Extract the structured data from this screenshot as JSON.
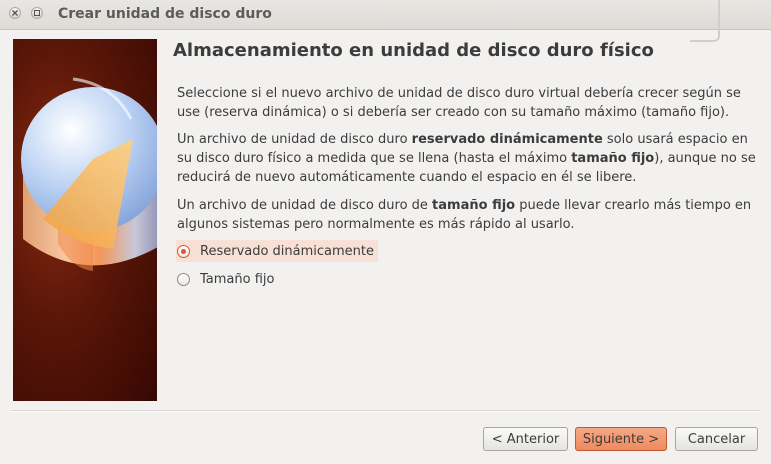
{
  "window": {
    "title": "Crear unidad de disco duro",
    "controls": [
      "close-icon",
      "maximize-icon"
    ]
  },
  "heading": "Almacenamiento en unidad de disco duro físico",
  "paragraphs": {
    "p1": "Seleccione si el nuevo archivo de unidad de disco duro virtual debería crecer según se use (reserva dinámica) o si debería ser creado con su tamaño máximo (tamaño fijo).",
    "p2": {
      "t1": "Un archivo de unidad de disco duro ",
      "b1": "reservado dinámicamente",
      "t2": " solo usará espacio en su disco duro físico a medida que se llena (hasta el máximo ",
      "b2": "tamaño fijo",
      "t3": "), aunque no se reducirá de nuevo automáticamente cuando el espacio en él se libere."
    },
    "p3": {
      "t1": "Un archivo de unidad de disco duro de ",
      "b1": "tamaño fijo",
      "t2": " puede llevar crearlo más tiempo en algunos sistemas pero normalmente es más rápido al usarlo."
    }
  },
  "options": [
    {
      "label": "Reservado dinámicamente",
      "selected": true
    },
    {
      "label": "Tamaño fijo",
      "selected": false
    }
  ],
  "buttons": {
    "back": "< Anterior",
    "next": "Siguiente >",
    "cancel": "Cancelar"
  },
  "colors": {
    "accent": "#ee8a5f",
    "selection": "#f8e0d6",
    "sidebar": "#5a1608"
  }
}
